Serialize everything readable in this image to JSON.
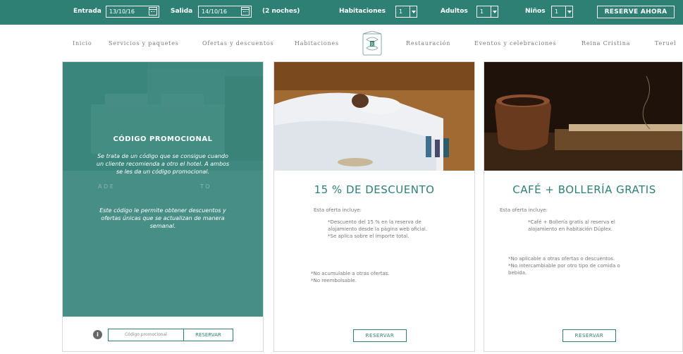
{
  "booking_bar": {
    "checkin_label": "Entrada",
    "checkin_value": "13/10/16",
    "checkout_label": "Salida",
    "checkout_value": "14/10/16",
    "nights": "(2 noches)",
    "rooms_label": "Habitaciones",
    "rooms_value": "1",
    "adults_label": "Adultos",
    "adults_value": "1",
    "children_label": "Niños",
    "children_value": "1",
    "reserve_button": "RESERVE AHORA",
    "bg_color": "#2e8075"
  },
  "nav": {
    "items": [
      "Inicio",
      "Servicios y paquetes",
      "Ofertas y descuentos",
      "Habitaciones",
      "Restauración",
      "Eventos y celebraciones",
      "Reina Cristina",
      "Teruel"
    ],
    "logo_icon": "hotel-crest-logo"
  },
  "promo_card": {
    "title": "CÓDIGO PROMOCIONAL",
    "text1": "Se trata de un código que se consigue cuando un cliente recomienda a otro el hotel. A ambos se les da un código promocional.",
    "text2": "Este código le permite obtener descuentos y ofertas únicas que se actualizan de manera semanal.",
    "info_icon": "i",
    "input_placeholder": "Código promocional",
    "button_label": "RESERVAR"
  },
  "offer_discount": {
    "title": "15 % DE DESCUENTO",
    "intro": "Esta oferta incluye:",
    "items": [
      "*Descuento del 15 % en la reserva de alojamiento desde la página web oficial.",
      "*Se aplica sobre el importe total."
    ],
    "notes": [
      "*No acumulable a otras ofertas.",
      "*No reembolsable."
    ],
    "button_label": "RESERVAR"
  },
  "offer_coffee": {
    "title": "CAFÉ + BOLLERÍA GRATIS",
    "intro": "Esta oferta incluye:",
    "items": [
      "*Café + Bollería gratis al reserva el alojamiento en habitación Dúplex."
    ],
    "notes": [
      "*No aplicable a otras ofertas o descuentos.",
      "*No intercambiable por otro tipo de comida o bebida."
    ],
    "button_label": "RESERVAR"
  }
}
